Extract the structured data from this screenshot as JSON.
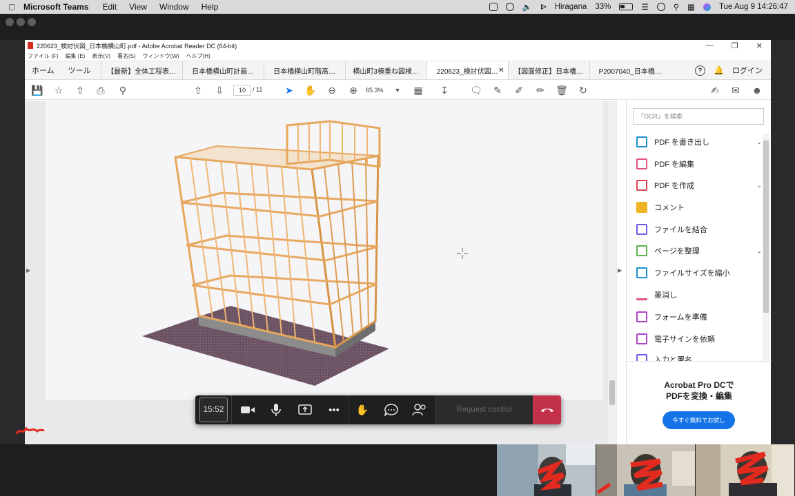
{
  "menubar": {
    "app": "Microsoft Teams",
    "items": [
      "Edit",
      "View",
      "Window",
      "Help"
    ],
    "input_source": "Hiragana",
    "battery": "33%",
    "datetime": "Tue Aug 9  14:26:47"
  },
  "acrobat": {
    "title": "220623_検討伏図_日本橋横山町.pdf - Adobe Acrobat Reader DC (64-bit)",
    "menu": [
      "ファイル (F)",
      "編集 (E)",
      "表示(V)",
      "署名(S)",
      "ウィンドウ(W)",
      "ヘルプ(H)"
    ],
    "home_tab": "ホーム",
    "tools_tab": "ツール",
    "tabs": [
      {
        "label": "【最新】全体工程表…",
        "active": false
      },
      {
        "label": "日本橋横山町計画…",
        "active": false
      },
      {
        "label": "日本橋横山町階高…",
        "active": false
      },
      {
        "label": "横山町3棟重ね図検…",
        "active": false
      },
      {
        "label": "220623_検討伏図…",
        "active": true
      },
      {
        "label": "【図面修正】日本橋…",
        "active": false
      },
      {
        "label": "P2007040_日本橋…",
        "active": false
      }
    ],
    "login": "ログイン",
    "page_current": "10",
    "page_total": "/ 11",
    "zoom": "65.3%"
  },
  "right_pane": {
    "search_placeholder": "「OCR」を検索",
    "items": [
      {
        "label": "PDF を書き出し",
        "color": "#1f8ecf",
        "chevron": true
      },
      {
        "label": "PDF を編集",
        "color": "#e0518c",
        "chevron": false
      },
      {
        "label": "PDF を作成",
        "color": "#e0434f",
        "chevron": true
      },
      {
        "label": "コメント",
        "color": "#f0b323",
        "chevron": false
      },
      {
        "label": "ファイルを結合",
        "color": "#6c5ce7",
        "chevron": false
      },
      {
        "label": "ページを整理",
        "color": "#5db34a",
        "chevron": true
      },
      {
        "label": "ファイルサイズを縮小",
        "color": "#1f8ecf",
        "chevron": false
      },
      {
        "label": "墨消し",
        "color": "#e0518c",
        "chevron": false
      },
      {
        "label": "フォームを準備",
        "color": "#b044c8",
        "chevron": false
      },
      {
        "label": "電子サインを依頼",
        "color": "#b044c8",
        "chevron": false
      },
      {
        "label": "入力と署名",
        "color": "#6c5ce7",
        "chevron": false
      }
    ],
    "promo_line1": "Acrobat Pro DCで",
    "promo_line2": "PDFを変換・編集",
    "promo_button": "今すぐ無料でお試し"
  },
  "callbar": {
    "timer": "15:52",
    "request_control": "Request control"
  }
}
